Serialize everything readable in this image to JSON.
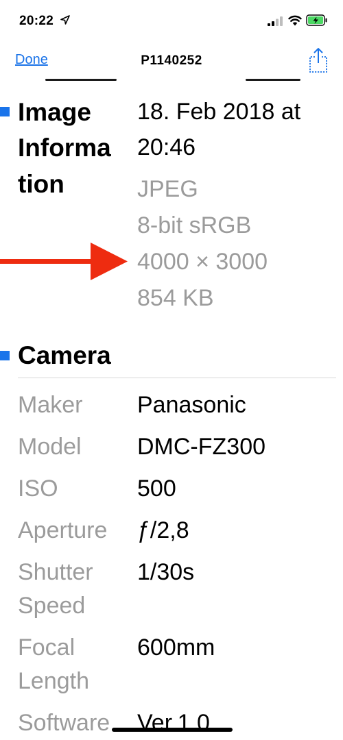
{
  "status_bar": {
    "time": "20:22"
  },
  "nav": {
    "done_label": "Done",
    "title": "P1140252"
  },
  "image_info": {
    "heading_lines": [
      "Image",
      "Informa",
      "tion"
    ],
    "date_lines": [
      "18. Feb 2018 at",
      "20:46"
    ],
    "format": "JPEG",
    "color_profile": "8-bit sRGB",
    "dimensions": "4000 × 3000",
    "file_size": "854 KB"
  },
  "camera": {
    "heading": "Camera",
    "rows": [
      {
        "label": "Maker",
        "value": "Panasonic"
      },
      {
        "label": "Model",
        "value": "DMC-FZ300"
      },
      {
        "label": "ISO",
        "value": "500"
      },
      {
        "label": "Aperture",
        "value": "ƒ/2,8"
      },
      {
        "label_lines": [
          "Shutter",
          "Speed"
        ],
        "value": "1/30s"
      },
      {
        "label_lines": [
          "Focal",
          "Length"
        ],
        "value": "600mm"
      },
      {
        "label": "Software",
        "value": "Ver.1.0"
      }
    ]
  },
  "colors": {
    "accent": "#1a73e8",
    "marker": "#1a74ea",
    "arrow": "#ee2c10",
    "secondary_text": "#9b9b9b"
  }
}
